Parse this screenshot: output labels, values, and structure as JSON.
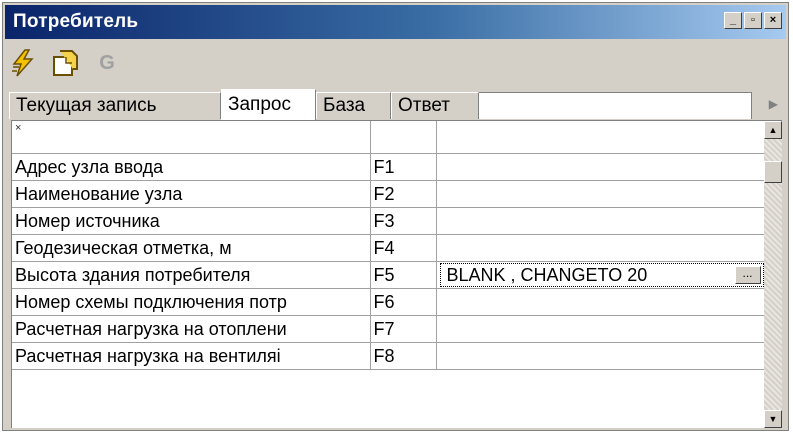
{
  "window": {
    "title": "Потребитель",
    "buttons": {
      "minimize": "_",
      "restore": "▫",
      "close": "×"
    }
  },
  "toolbar": {
    "icons": [
      "lightning-icon",
      "new-page-icon",
      "g-letter-icon"
    ],
    "g_label": "G"
  },
  "tabs": [
    {
      "label": "Текущая запись",
      "active": false
    },
    {
      "label": "Запрос",
      "active": true
    },
    {
      "label": "База",
      "active": false
    },
    {
      "label": "Ответ",
      "active": false
    }
  ],
  "grid": {
    "header_marker": "×",
    "rows": [
      {
        "name": "Адрес узла ввода",
        "field": "F1",
        "value": ""
      },
      {
        "name": "Наименование узла",
        "field": "F2",
        "value": ""
      },
      {
        "name": "Номер источника",
        "field": "F3",
        "value": ""
      },
      {
        "name": "Геодезическая отметка, м",
        "field": "F4",
        "value": ""
      },
      {
        "name": "Высота здания потребителя",
        "field": "F5",
        "value": "BLANK , CHANGETO 20",
        "editing": true
      },
      {
        "name": "Номер схемы подключения потр",
        "field": "F6",
        "value": ""
      },
      {
        "name": "Расчетная нагрузка на отоплени",
        "field": "F7",
        "value": ""
      },
      {
        "name": "Расчетная нагрузка на вентиляі",
        "field": "F8",
        "value": ""
      }
    ],
    "ellipsis_label": "..."
  },
  "colors": {
    "title_start": "#0a246a",
    "title_end": "#a6caf0",
    "face": "#d4d0c8",
    "bolt": "#f2c200",
    "page": "#e8b400"
  }
}
